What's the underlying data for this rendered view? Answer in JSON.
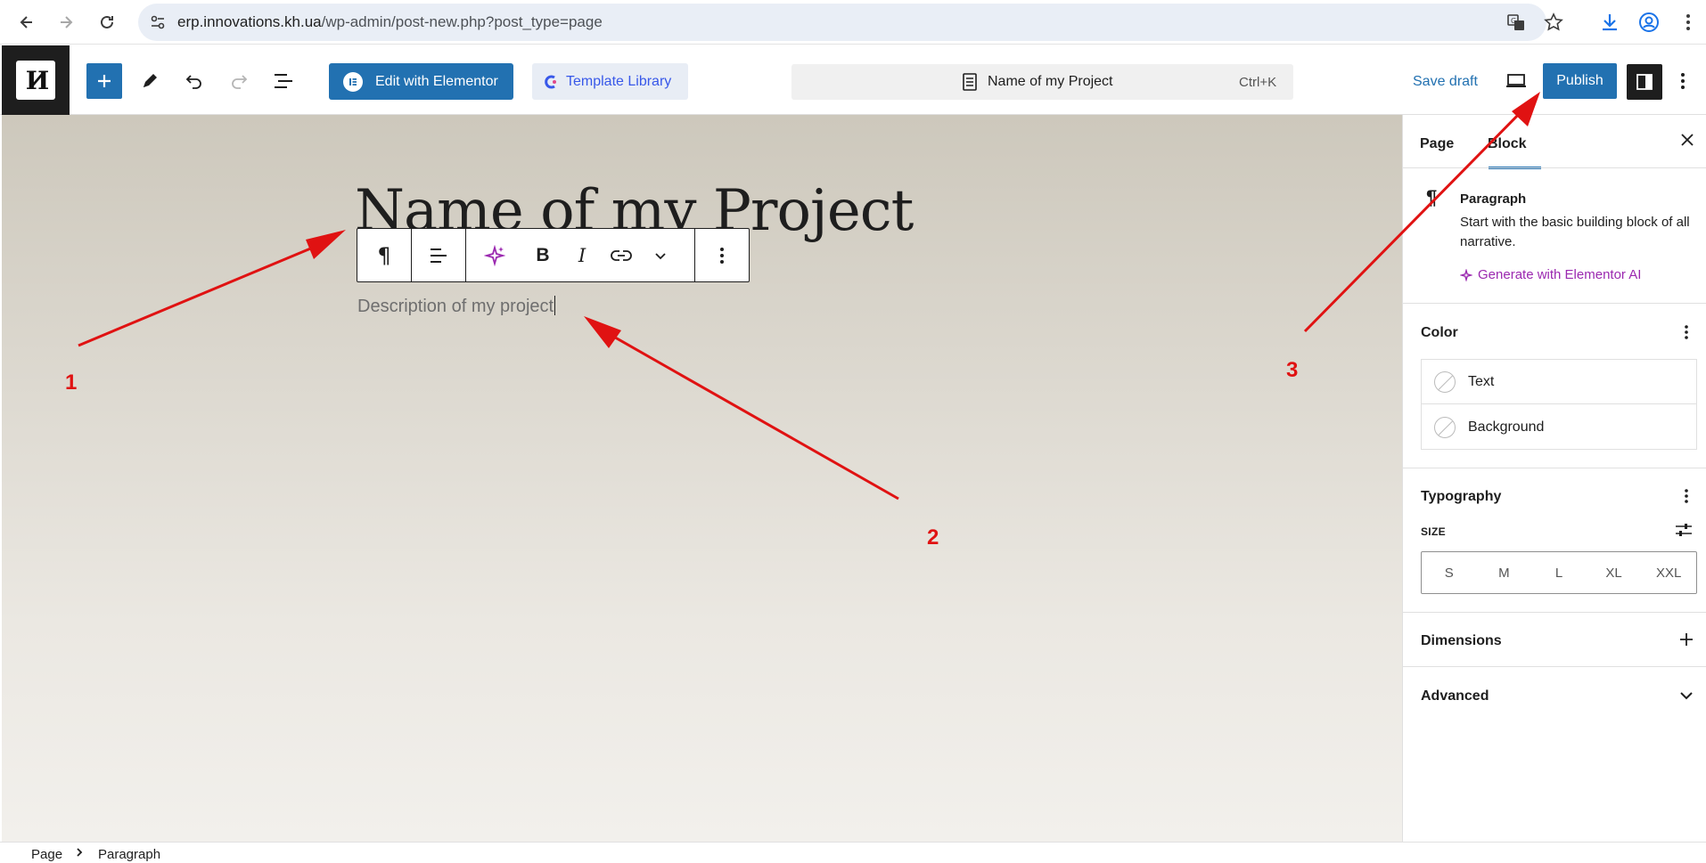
{
  "browser": {
    "url_host": "erp.innovations.kh.ua",
    "url_path": "/wp-admin/post-new.php?post_type=page",
    "icons": [
      "back-icon",
      "forward-icon",
      "reload-icon",
      "site-info-icon",
      "translate-icon",
      "bookmark-star-icon",
      "download-icon",
      "profile-icon",
      "menu-kebab-icon"
    ]
  },
  "toolbar": {
    "logo_text": "И",
    "edit_elementor_label": "Edit with Elementor",
    "template_library_label": "Template Library",
    "document_title": "Name of my Project",
    "shortcut": "Ctrl+K",
    "save_draft_label": "Save draft",
    "publish_label": "Publish"
  },
  "canvas": {
    "title": "Name of my Project",
    "description": "Description of my project"
  },
  "sidebar": {
    "tabs": [
      "Page",
      "Block"
    ],
    "active_tab": "Block",
    "block_name": "Paragraph",
    "block_description": "Start with the basic building block of all narrative.",
    "generate_ai_label": "Generate with Elementor AI",
    "color_heading": "Color",
    "color_items": [
      "Text",
      "Background"
    ],
    "typography_heading": "Typography",
    "size_label": "SIZE",
    "sizes": [
      "S",
      "M",
      "L",
      "XL",
      "XXL"
    ],
    "dimensions_heading": "Dimensions",
    "advanced_heading": "Advanced"
  },
  "breadcrumb": {
    "items": [
      "Page",
      "Paragraph"
    ]
  },
  "annotations": {
    "labels": [
      "1",
      "2",
      "3"
    ],
    "color": "#e01212"
  },
  "colors": {
    "accent": "#2271b1",
    "ai_purple": "#9b29b0"
  }
}
